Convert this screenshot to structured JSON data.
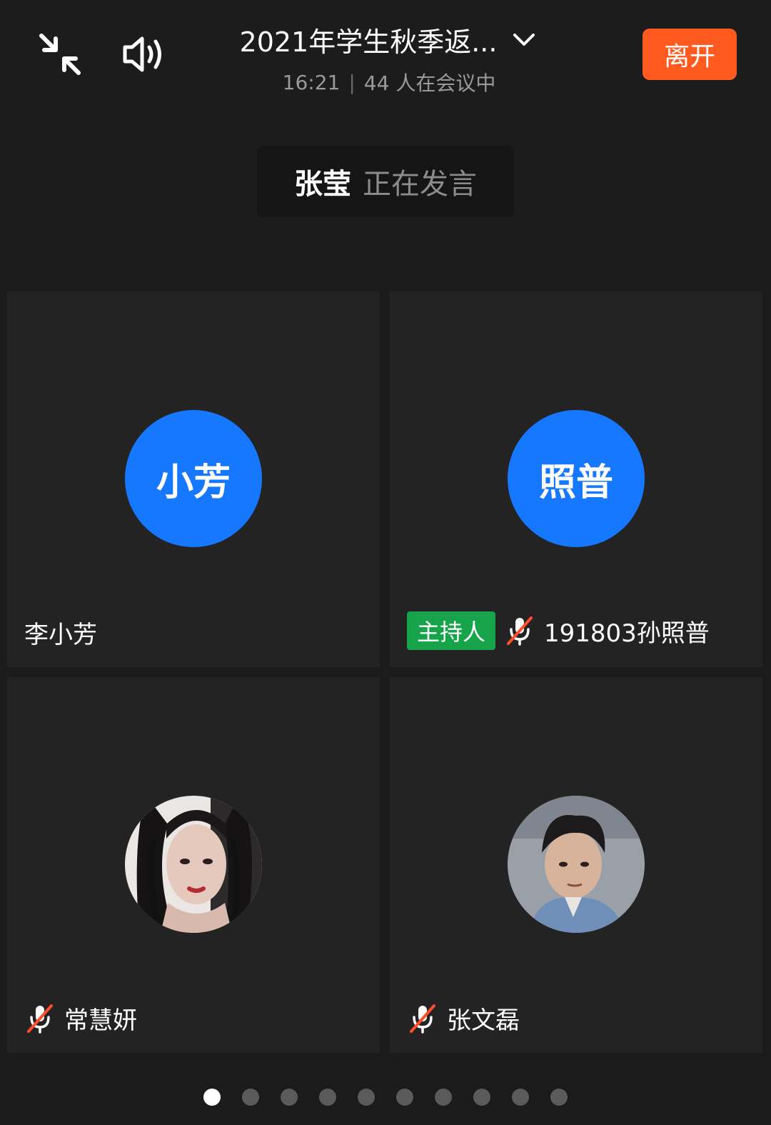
{
  "header": {
    "meeting_title": "2021年学生秋季返...",
    "time": "16:21",
    "separator": "|",
    "participants_text": "44 人在会议中",
    "leave_label": "离开"
  },
  "speaking": {
    "name": "张莹",
    "status": "正在发言"
  },
  "participants": [
    {
      "name": "李小芳",
      "avatar_text": "小芳",
      "avatar_type": "initials",
      "muted": false,
      "host": false
    },
    {
      "name": "191803孙照普",
      "avatar_text": "照普",
      "avatar_type": "initials",
      "muted": true,
      "host": true,
      "host_label": "主持人"
    },
    {
      "name": "常慧妍",
      "avatar_type": "photo",
      "muted": true,
      "host": false
    },
    {
      "name": "张文磊",
      "avatar_type": "photo",
      "muted": true,
      "host": false
    }
  ],
  "pagination": {
    "total": 10,
    "active": 1
  },
  "colors": {
    "accent_blue": "#1677ff",
    "leave_orange": "#ff5a1f",
    "host_green": "#16a34a",
    "mute_red": "#ff4d2e"
  }
}
